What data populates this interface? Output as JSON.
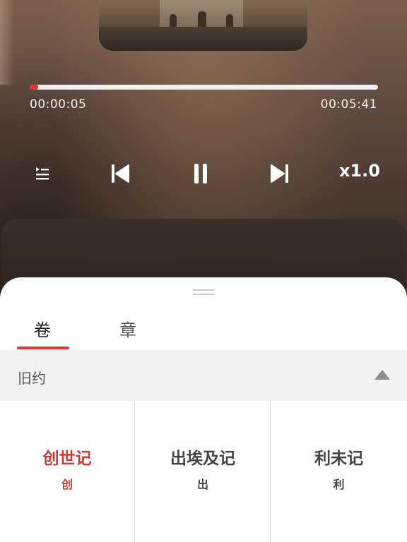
{
  "player": {
    "current_time": "00:00:05",
    "total_time": "00:05:41",
    "progress_fraction": 0.015,
    "speed_label": "x1.0",
    "accent_color": "#e2372b",
    "controls": {
      "playlist_icon": "playlist-icon",
      "previous_icon": "skip-previous-icon",
      "pause_icon": "pause-icon",
      "next_icon": "skip-next-icon"
    }
  },
  "sheet": {
    "tabs": [
      {
        "label": "卷",
        "active": true
      },
      {
        "label": "章",
        "active": false
      }
    ],
    "section": {
      "title": "旧约",
      "toggle_icon": "triangle-up-icon"
    },
    "books": [
      {
        "name": "创世记",
        "abbr": "创",
        "active": true
      },
      {
        "name": "出埃及记",
        "abbr": "出",
        "active": false
      },
      {
        "name": "利未记",
        "abbr": "利",
        "active": false
      }
    ]
  }
}
